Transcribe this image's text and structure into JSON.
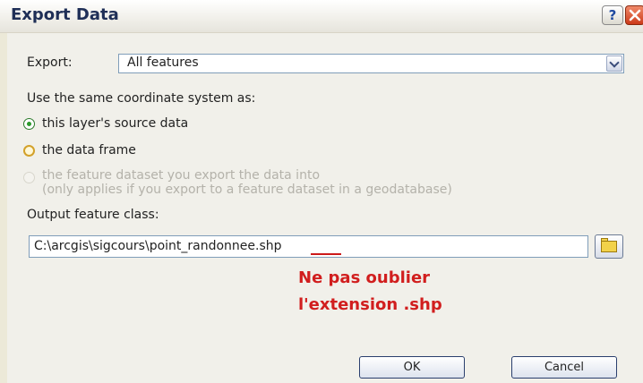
{
  "window": {
    "title": "Export Data",
    "help_label": "?"
  },
  "export": {
    "label": "Export:",
    "value": "All features"
  },
  "coordinate_system": {
    "heading": "Use the same coordinate system as:",
    "options": [
      {
        "label": "this layer's source data",
        "selected": true,
        "enabled": true
      },
      {
        "label": "the data frame",
        "selected": false,
        "enabled": true
      },
      {
        "label": "the feature dataset you export the data into",
        "sublabel": "(only applies if you export to a feature dataset in a geodatabase)",
        "selected": false,
        "enabled": false
      }
    ]
  },
  "output": {
    "label": "Output feature class:",
    "value": "C:\\arcgis\\sigcours\\point_randonnee.shp"
  },
  "annotation": {
    "line1": "Ne pas oublier",
    "line2": "l'extension .shp",
    "color": "#d11e1e"
  },
  "buttons": {
    "ok": "OK",
    "cancel": "Cancel"
  }
}
